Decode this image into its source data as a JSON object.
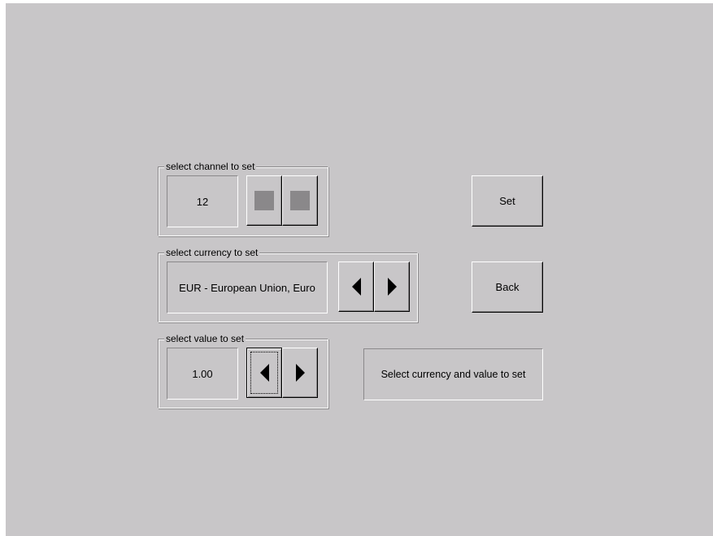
{
  "channel_group": {
    "legend": "select channel to set",
    "value": "12",
    "prev_icon": "square-icon",
    "next_icon": "square-icon"
  },
  "currency_group": {
    "legend": "select currency to set",
    "value": "EUR - European Union, Euro",
    "prev_icon": "arrow-left-icon",
    "next_icon": "arrow-right-icon"
  },
  "value_group": {
    "legend": "select value to set",
    "value": "1.00",
    "prev_icon": "arrow-left-icon",
    "next_icon": "arrow-right-icon"
  },
  "actions": {
    "set_label": "Set",
    "back_label": "Back"
  },
  "status": {
    "message": "Select currency and value to set"
  },
  "colors": {
    "background": "#c8c6c8",
    "shadow": "#8a888a",
    "highlight": "#ffffff"
  }
}
